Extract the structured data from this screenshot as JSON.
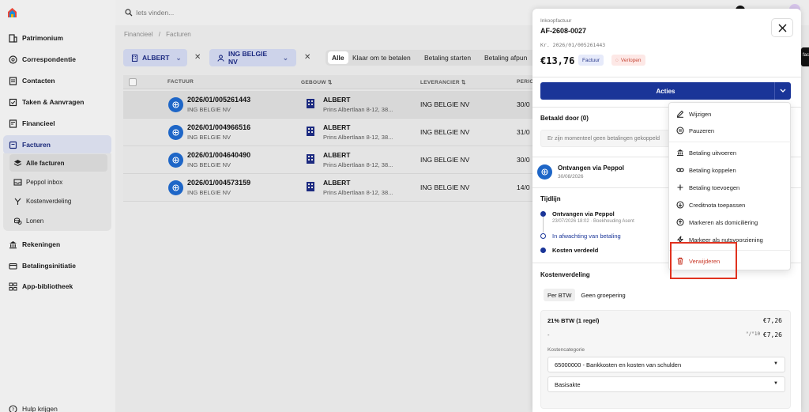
{
  "sidebar": {
    "items": [
      {
        "label": "Patrimonium",
        "icon": "building-icon"
      },
      {
        "label": "Correspondentie",
        "icon": "mail-icon"
      },
      {
        "label": "Contacten",
        "icon": "contacts-icon"
      },
      {
        "label": "Taken & Aanvragen",
        "icon": "tasks-icon"
      },
      {
        "label": "Financieel",
        "icon": "finance-icon"
      },
      {
        "label": "Facturen",
        "icon": "invoice-icon"
      }
    ],
    "sub_items": [
      {
        "label": "Alle facturen",
        "icon": "layers-icon"
      },
      {
        "label": "Peppol inbox",
        "icon": "inbox-icon"
      },
      {
        "label": "Kostenverdeling",
        "icon": "split-icon"
      },
      {
        "label": "Lonen",
        "icon": "coins-icon"
      }
    ],
    "items_after": [
      {
        "label": "Rekeningen",
        "icon": "bank-icon"
      },
      {
        "label": "Betalingsinitiatie",
        "icon": "payment-icon"
      },
      {
        "label": "App-bibliotheek",
        "icon": "grid-icon"
      }
    ],
    "help": "Hulp krijgen"
  },
  "search": {
    "placeholder": "Iets vinden..."
  },
  "breadcrumb": [
    "Financieel",
    "/",
    "Facturen"
  ],
  "filters": {
    "building_chip": "ALBERT",
    "supplier_chip": "ING BELGIE NV",
    "tabs": [
      "Alle",
      "Klaar om te betalen",
      "Betaling starten",
      "Betaling afpun"
    ]
  },
  "table": {
    "headers": [
      "FACTUUR",
      "GEBOUW",
      "LEVERANCIER",
      "PERIO"
    ],
    "rows": [
      {
        "invoice": "2026/01/005261443",
        "supplier_sub": "ING BELGIE NV",
        "building": "ALBERT",
        "address": "Prins Albertlaan 8-12, 38...",
        "supplier": "ING BELGIE NV",
        "period": "30/0"
      },
      {
        "invoice": "2026/01/004966516",
        "supplier_sub": "ING BELGIE NV",
        "building": "ALBERT",
        "address": "Prins Albertlaan 8-12, 38...",
        "supplier": "ING BELGIE NV",
        "period": "31/0"
      },
      {
        "invoice": "2026/01/004640490",
        "supplier_sub": "ING BELGIE NV",
        "building": "ALBERT",
        "address": "Prins Albertlaan 8-12, 38...",
        "supplier": "ING BELGIE NV",
        "period": "30/0"
      },
      {
        "invoice": "2026/01/004573159",
        "supplier_sub": "ING BELGIE NV",
        "building": "ALBERT",
        "address": "Prins Albertlaan 8-12, 38...",
        "supplier": "ING BELGIE NV",
        "period": "14/0"
      }
    ]
  },
  "drawer": {
    "subtitle": "Inkoopfactuur",
    "title": "AF-2608-0027",
    "ref": "Kr. 2026/01/005261443",
    "amount": "€13,76",
    "type_badge": "Factuur",
    "status_badge": "Verlopen",
    "actions_label": "Acties",
    "paid_by_title": "Betaald door (0)",
    "paid_by_empty": "Er zijn momenteel geen betalingen gekoppeld",
    "received_title": "Ontvangen via Peppol",
    "received_date": "30/08/2026",
    "timeline_title": "Tijdlijn",
    "timeline": [
      {
        "title": "Ontvangen via Peppol",
        "sub": "23/07/2026 18:02 · Boekhouding Asent"
      },
      {
        "title": "In afwachting van betaling",
        "sub": ""
      },
      {
        "title": "Kosten verdeeld",
        "sub": ""
      }
    ],
    "cost_title": "Kostenverdeling",
    "cost_tabs": [
      "Per BTW",
      "Geen groepering"
    ],
    "vat_line": "21% BTW (1 regel)",
    "vat_amount": "€7,26",
    "dash": "-",
    "vat_code": "°/°10",
    "line_amount": "€7,26",
    "category_label": "Kostencategorie",
    "category_value": "65000000 - Bankkosten en kosten van schulden",
    "basis_value": "Basisakte"
  },
  "menu": {
    "items": [
      {
        "label": "Wijzigen",
        "icon": "pencil-icon"
      },
      {
        "label": "Pauzeren",
        "icon": "pause-icon"
      },
      {
        "label": "Betaling uitvoeren",
        "icon": "bank-icon"
      },
      {
        "label": "Betaling koppelen",
        "icon": "link-icon"
      },
      {
        "label": "Betaling toevoegen",
        "icon": "plus-icon"
      },
      {
        "label": "Creditnota toepassen",
        "icon": "credit-icon"
      },
      {
        "label": "Markeren als domiciliëring",
        "icon": "arrow-up-circle-icon"
      },
      {
        "label": "Markeer als nutsvoorziening",
        "icon": "bolt-icon"
      },
      {
        "label": "Verwijderen",
        "icon": "trash-icon"
      }
    ]
  },
  "edge_label": "fac",
  "colors": {
    "accent": "#1a3598",
    "danger": "#c93a2a",
    "highlight": "#e0321f",
    "peppol": "#1e66c7"
  }
}
